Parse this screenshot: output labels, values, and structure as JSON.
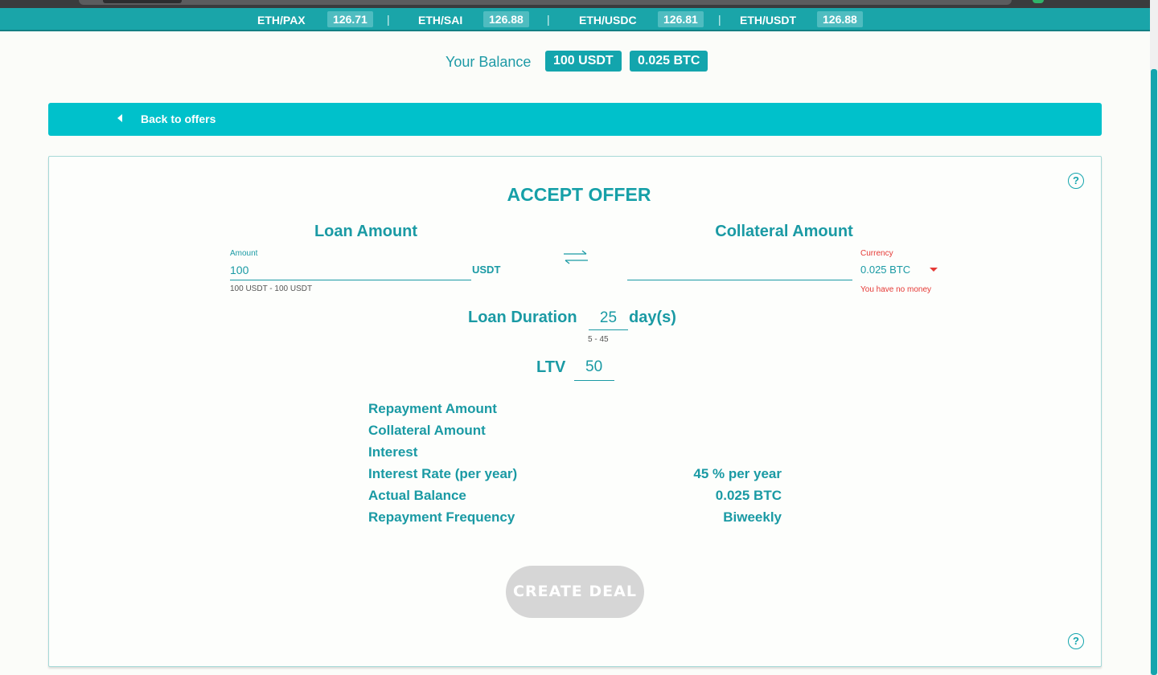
{
  "ticker": [
    {
      "pair": "ETH/PAX",
      "price": "126.71"
    },
    {
      "pair": "ETH/SAI",
      "price": "126.88"
    },
    {
      "pair": "ETH/USDC",
      "price": "126.81"
    },
    {
      "pair": "ETH/USDT",
      "price": "126.88"
    }
  ],
  "ticker_separator": "|",
  "balance": {
    "label": "Your Balance",
    "badges": [
      "100 USDT",
      "0.025 BTC"
    ]
  },
  "back_link": "Back to offers",
  "offer": {
    "title": "ACCEPT OFFER",
    "loan": {
      "heading": "Loan Amount",
      "field_label": "Amount",
      "value": "100",
      "unit": "USDT",
      "range_hint": "100 USDT - 100 USDT"
    },
    "collateral": {
      "heading": "Collateral Amount",
      "value": "",
      "currency_label": "Currency",
      "currency_value": "0.025 BTC",
      "error": "You have no money"
    },
    "duration": {
      "label": "Loan Duration",
      "value": "25",
      "unit": "day(s)",
      "range_hint": "5 - 45"
    },
    "ltv": {
      "label": "LTV",
      "value": "50"
    },
    "summary": [
      {
        "label": "Repayment Amount",
        "value": ""
      },
      {
        "label": "Collateral Amount",
        "value": ""
      },
      {
        "label": "Interest",
        "value": ""
      },
      {
        "label": "Interest Rate (per year)",
        "value": "45 % per year"
      },
      {
        "label": "Actual Balance",
        "value": "0.025 BTC"
      },
      {
        "label": "Repayment Frequency",
        "value": "Biweekly"
      }
    ],
    "create_button": "CREATE DEAL",
    "help_glyph": "?"
  },
  "colors": {
    "accent": "#13a5ad",
    "back_bar": "#00c1cb",
    "error": "#e53935",
    "disabled_button": "#d6d6d6"
  }
}
